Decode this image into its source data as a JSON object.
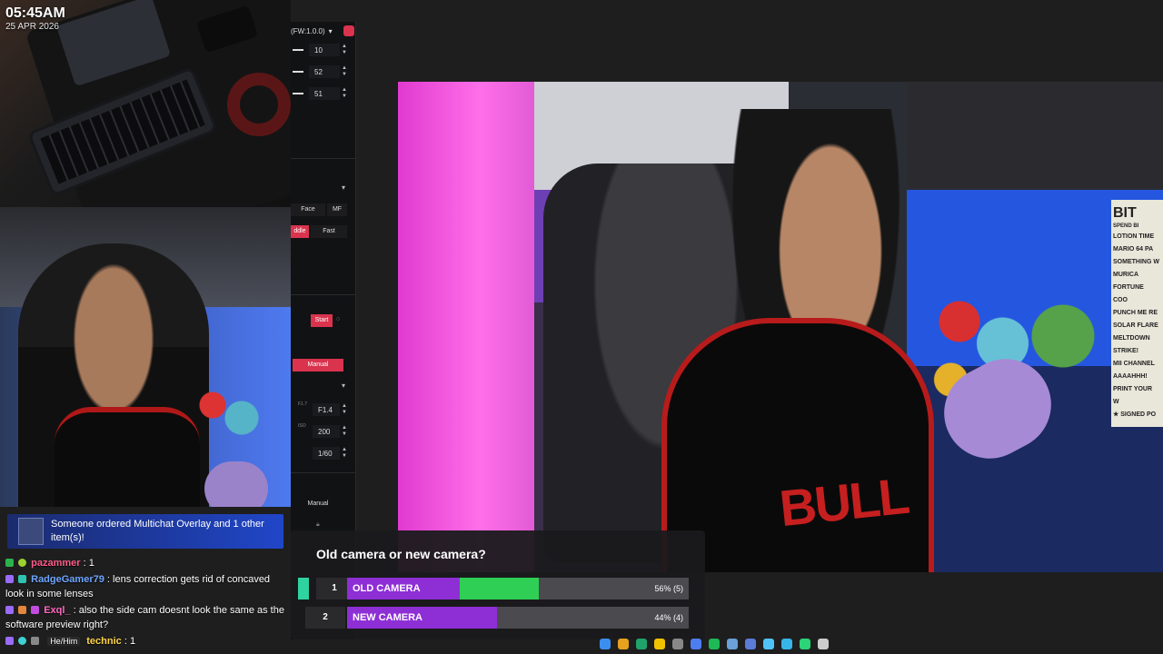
{
  "clock": {
    "time": "05:45AM",
    "date": "25 APR 2026"
  },
  "panel": {
    "firmware": "(FW:1.0.0)",
    "values": [
      "10",
      "52",
      "51"
    ],
    "focus_buttons": [
      "Face",
      "MF"
    ],
    "speed_buttons": [
      "ddle",
      "Fast"
    ],
    "start_label": "Start",
    "manual_label": "Manual",
    "aperture": "F1.4",
    "iso": "200",
    "shutter": "1/60",
    "manual2_label": "Manual",
    "aperture_tag": "F1.7",
    "iso_tag": "ISO"
  },
  "sign": {
    "header": "BIT",
    "sub": "SPEND BI",
    "items": [
      "LOTION TIME",
      "MARIO 64 PA",
      "SOMETHING W",
      "MURICA",
      "FORTUNE COO",
      "PUNCH ME RE",
      "SOLAR FLARE",
      "MELTDOWN",
      "STRIKE!",
      "MII CHANNEL",
      "AAAAHHH!",
      "PRINT YOUR W",
      "★ SIGNED PO"
    ]
  },
  "jersey_text": "BULL",
  "chat": {
    "alert": "Someone ordered Multichat Overlay and 1 other item(s)!",
    "messages": [
      {
        "user": "pazammer",
        "text": ": 1"
      },
      {
        "user": "RadgeGamer79",
        "text": ": lens correction gets rid of concaved look in some lenses"
      },
      {
        "user": "Exql_",
        "text": ": also the side cam doesnt look the same as the software preview right?"
      },
      {
        "user": "technic",
        "pronouns": "He/Him",
        "text": ": 1"
      }
    ]
  },
  "poll": {
    "question": "Old camera or new camera?",
    "options": [
      {
        "index": "1",
        "label": "OLD CAMERA",
        "result": "56% (5)",
        "share": 0.56
      },
      {
        "index": "2",
        "label": "NEW CAMERA",
        "result": "44% (4)",
        "share": 0.44
      }
    ]
  },
  "colors": {
    "accent": "#d9334e",
    "poll_purple": "#8e2fd6",
    "poll_green": "#2fcf55",
    "alert_blue": "#2046c8"
  },
  "taskbar_icons": [
    "windows-icon",
    "chrome-icon",
    "edge-icon",
    "explorer-icon",
    "settings-icon",
    "app-icon",
    "spotify-icon",
    "app2-icon",
    "app3-icon",
    "app4-icon",
    "app5-icon",
    "nvidia-icon",
    "obs-icon"
  ]
}
